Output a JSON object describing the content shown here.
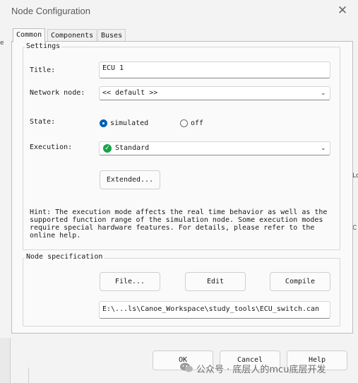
{
  "window": {
    "title": "Node Configuration"
  },
  "tabs": [
    {
      "label": "Common",
      "active": true
    },
    {
      "label": "Components",
      "active": false
    },
    {
      "label": "Buses",
      "active": false
    }
  ],
  "settings": {
    "group_title": "Settings",
    "title_label": "Title:",
    "title_value": "ECU 1",
    "network_label": "Network node:",
    "network_value": "<< default >>",
    "state_label": "State:",
    "state_options": [
      {
        "label": "simulated",
        "selected": true
      },
      {
        "label": "off",
        "selected": false
      }
    ],
    "execution_label": "Execution:",
    "execution_value": "Standard",
    "extended_button": "Extended...",
    "hint": "Hint: The execution mode affects the real time behavior as well as the\nsupported function range of the simulation node. Some execution modes\nrequire special hardware features. For details, please refer to the\nonline help."
  },
  "node_spec": {
    "group_title": "Node specification",
    "file_button": "File...",
    "edit_button": "Edit",
    "compile_button": "Compile",
    "path_value": "E:\\...ls\\Canoe_Workspace\\study_tools\\ECU_switch.can"
  },
  "footer": {
    "ok_button": "OK",
    "cancel_button": "Cancel",
    "help_button": "Help"
  },
  "watermark": {
    "text": "公众号 · 底层人的mcu底层开发"
  },
  "colors": {
    "accent": "#005fb8",
    "status_green": "#16a34a"
  }
}
